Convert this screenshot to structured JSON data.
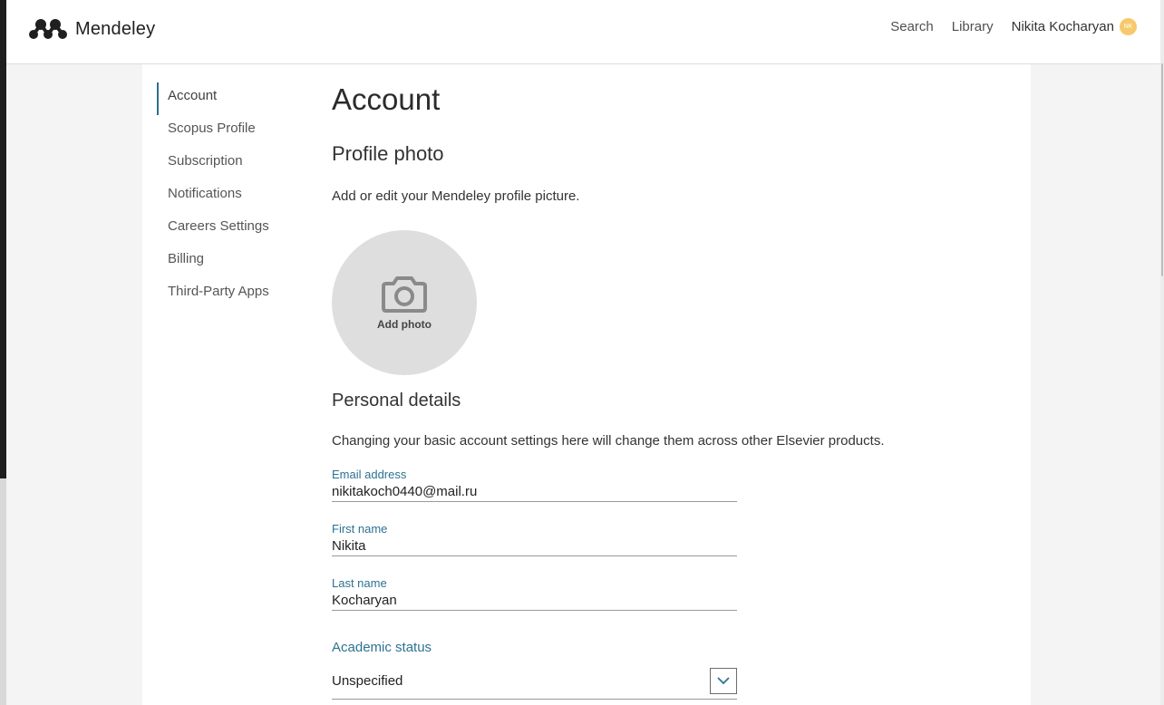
{
  "app": {
    "logo_text": "Mendeley",
    "brand_color": "#2d7293"
  },
  "topnav": {
    "search_label": "Search",
    "library_label": "Library",
    "user_name": "Nikita Kocharyan",
    "user_initials": "NK"
  },
  "sidebar": {
    "items": [
      {
        "label": "Account",
        "active": true
      },
      {
        "label": "Scopus Profile"
      },
      {
        "label": "Subscription"
      },
      {
        "label": "Notifications"
      },
      {
        "label": "Careers Settings"
      },
      {
        "label": "Billing"
      },
      {
        "label": "Third-Party Apps"
      }
    ]
  },
  "main": {
    "title": "Account",
    "profile_photo": {
      "heading": "Profile photo",
      "description": "Add or edit your Mendeley profile picture.",
      "add_photo_label": "Add photo",
      "icon": "camera-icon"
    },
    "personal_details": {
      "heading": "Personal details",
      "description": "Changing your basic account settings here will change them across other Elsevier products.",
      "email": {
        "label": "Email address",
        "value": "nikitakoch0440@mail.ru"
      },
      "first_name": {
        "label": "First name",
        "value": "Nikita"
      },
      "last_name": {
        "label": "Last name",
        "value": "Kocharyan"
      },
      "academic_status": {
        "label": "Academic status",
        "value": "Unspecified",
        "icon": "chevron-down-icon"
      }
    }
  }
}
